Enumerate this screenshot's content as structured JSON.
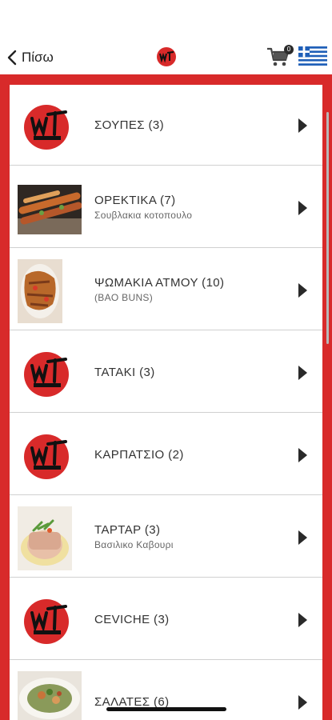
{
  "header": {
    "back_label": "Πίσω",
    "cart_count": "0",
    "logo_text": "ωΓ",
    "language_flag": "greek-flag"
  },
  "theme": {
    "accent": "#d82a2a",
    "text": "#333333",
    "divider": "#d0d0d0"
  },
  "categories": [
    {
      "title": "ΣΟΥΠΕΣ (3)",
      "subtitle": "",
      "image": "logo"
    },
    {
      "title": "ΟΡΕΚΤΙΚΑ (7)",
      "subtitle": "Σουβλακια κοτοπουλο",
      "image": "skewers-photo"
    },
    {
      "title": "ΨΩΜΑΚΙΑ ΑΤΜΟΥ (10)",
      "subtitle": "(BAO BUNS)",
      "image": "bao-photo"
    },
    {
      "title": "TATAKI (3)",
      "subtitle": "",
      "image": "logo"
    },
    {
      "title": "ΚΑΡΠΑΤΣΙΟ (2)",
      "subtitle": "",
      "image": "logo"
    },
    {
      "title": "ΤΑΡΤΑΡ (3)",
      "subtitle": "Βασιλικο Καβουρι",
      "image": "tartare-photo"
    },
    {
      "title": "CEVICHE (3)",
      "subtitle": "",
      "image": "logo"
    },
    {
      "title": "ΣΑΛΑΤΕΣ (6)",
      "subtitle": "",
      "image": "salad-photo"
    }
  ]
}
